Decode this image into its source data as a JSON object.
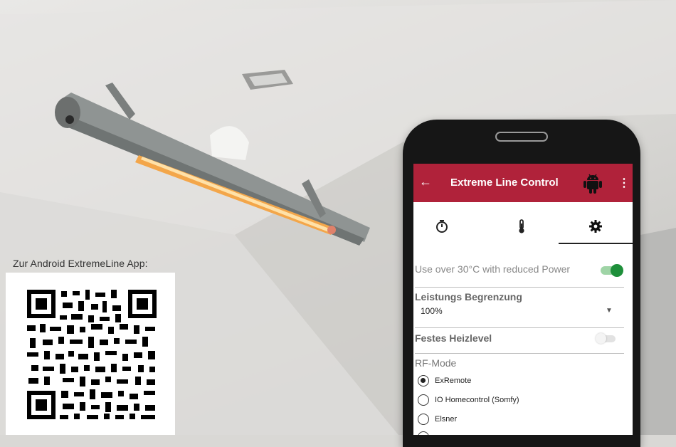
{
  "caption": {
    "text": "Zur Android ExtremeLine App:"
  },
  "app": {
    "title": "Extreme Line Control",
    "bar_color": "#b0223a",
    "back_icon": "arrow-left-icon",
    "menu_icon": "more-vert-icon",
    "brand_icon": "android-icon",
    "tabs": [
      {
        "icon": "timer-icon",
        "active": false
      },
      {
        "icon": "thermometer-icon",
        "active": false
      },
      {
        "icon": "gear-icon",
        "active": true
      }
    ],
    "settings": {
      "reduced_power": {
        "label": "Use over 30°C with reduced Power",
        "enabled": true
      },
      "power_limit": {
        "label": "Leistungs Begrenzung",
        "value": "100%"
      },
      "fixed_level": {
        "label": "Festes Heizlevel",
        "enabled": false
      },
      "rf_mode": {
        "label": "RF-Mode",
        "options": [
          "ExRemote",
          "IO Homecontrol (Somfy)",
          "Elsner"
        ],
        "selected": "ExRemote"
      }
    }
  }
}
